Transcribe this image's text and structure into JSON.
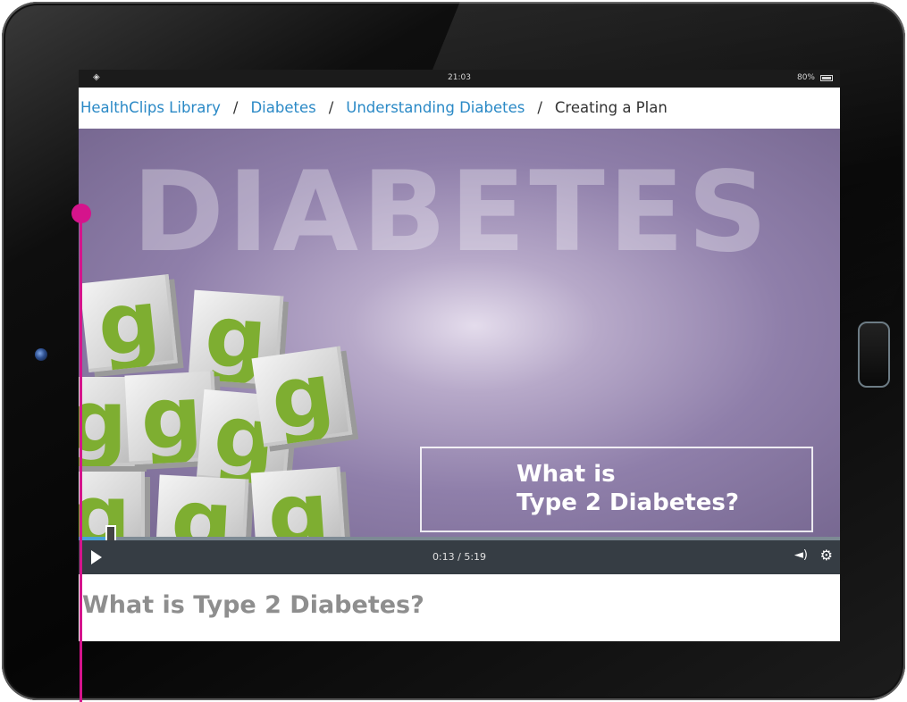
{
  "status_bar": {
    "time": "21:03",
    "battery": "80%",
    "wifi_icon": "wifi-icon",
    "battery_icon": "battery-icon"
  },
  "breadcrumb": {
    "items": [
      "HealthClips Library",
      "Diabetes",
      "Understanding Diabetes"
    ],
    "current": "Creating a Plan",
    "separator": "/"
  },
  "video": {
    "background_title": "DIABETES",
    "block_letter": "g",
    "caption_line1": "What is",
    "caption_line2": "Type 2 Diabetes?",
    "progress": 0.04,
    "time_display": "0:13 / 5:19",
    "volume_icon": "volume-icon",
    "settings_icon": "gear-icon"
  },
  "video_heading": "What is Type 2 Diabetes?",
  "colors": {
    "link": "#2a89c6",
    "marker": "#d5148c",
    "block_letter": "#7eae31",
    "controls_bg": "#363d44"
  }
}
